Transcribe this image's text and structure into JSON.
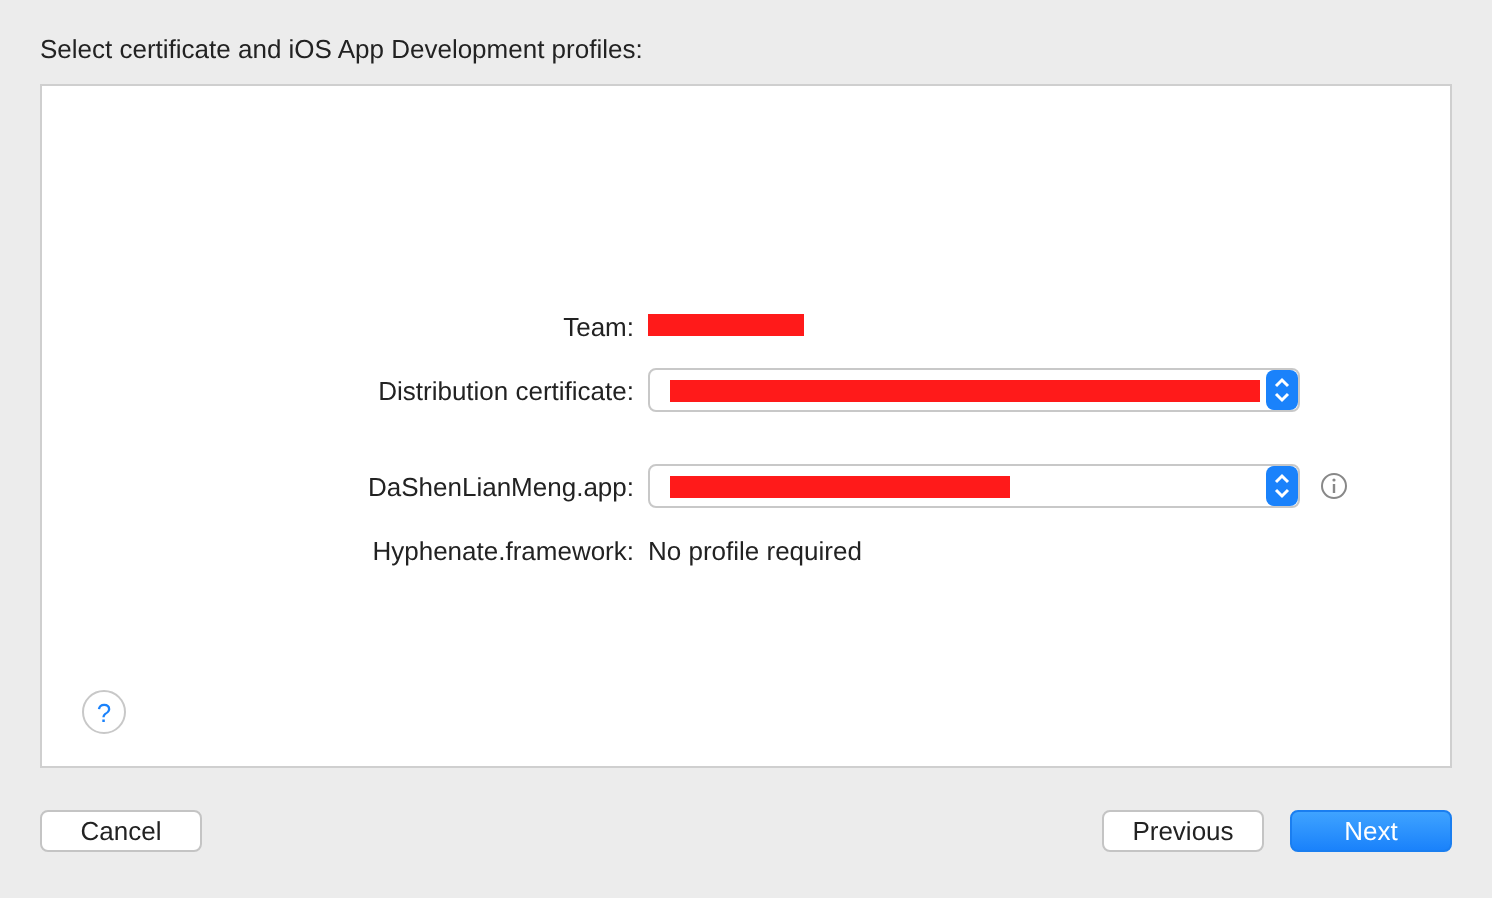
{
  "title": "Select certificate and iOS App Development profiles:",
  "rows": [
    {
      "label": "Team:",
      "kind": "redacted"
    },
    {
      "label": "Distribution certificate:",
      "kind": "popup",
      "info": false
    },
    {
      "label": "DaShenLianMeng.app:",
      "kind": "popup",
      "info": true
    },
    {
      "label": "Hyphenate.framework:",
      "kind": "text",
      "value": "No profile required"
    }
  ],
  "help": "?",
  "buttons": [
    {
      "label": "Cancel",
      "kind": "plain"
    },
    {
      "label": "Previous",
      "kind": "plain"
    },
    {
      "label": "Next",
      "kind": "default"
    }
  ]
}
